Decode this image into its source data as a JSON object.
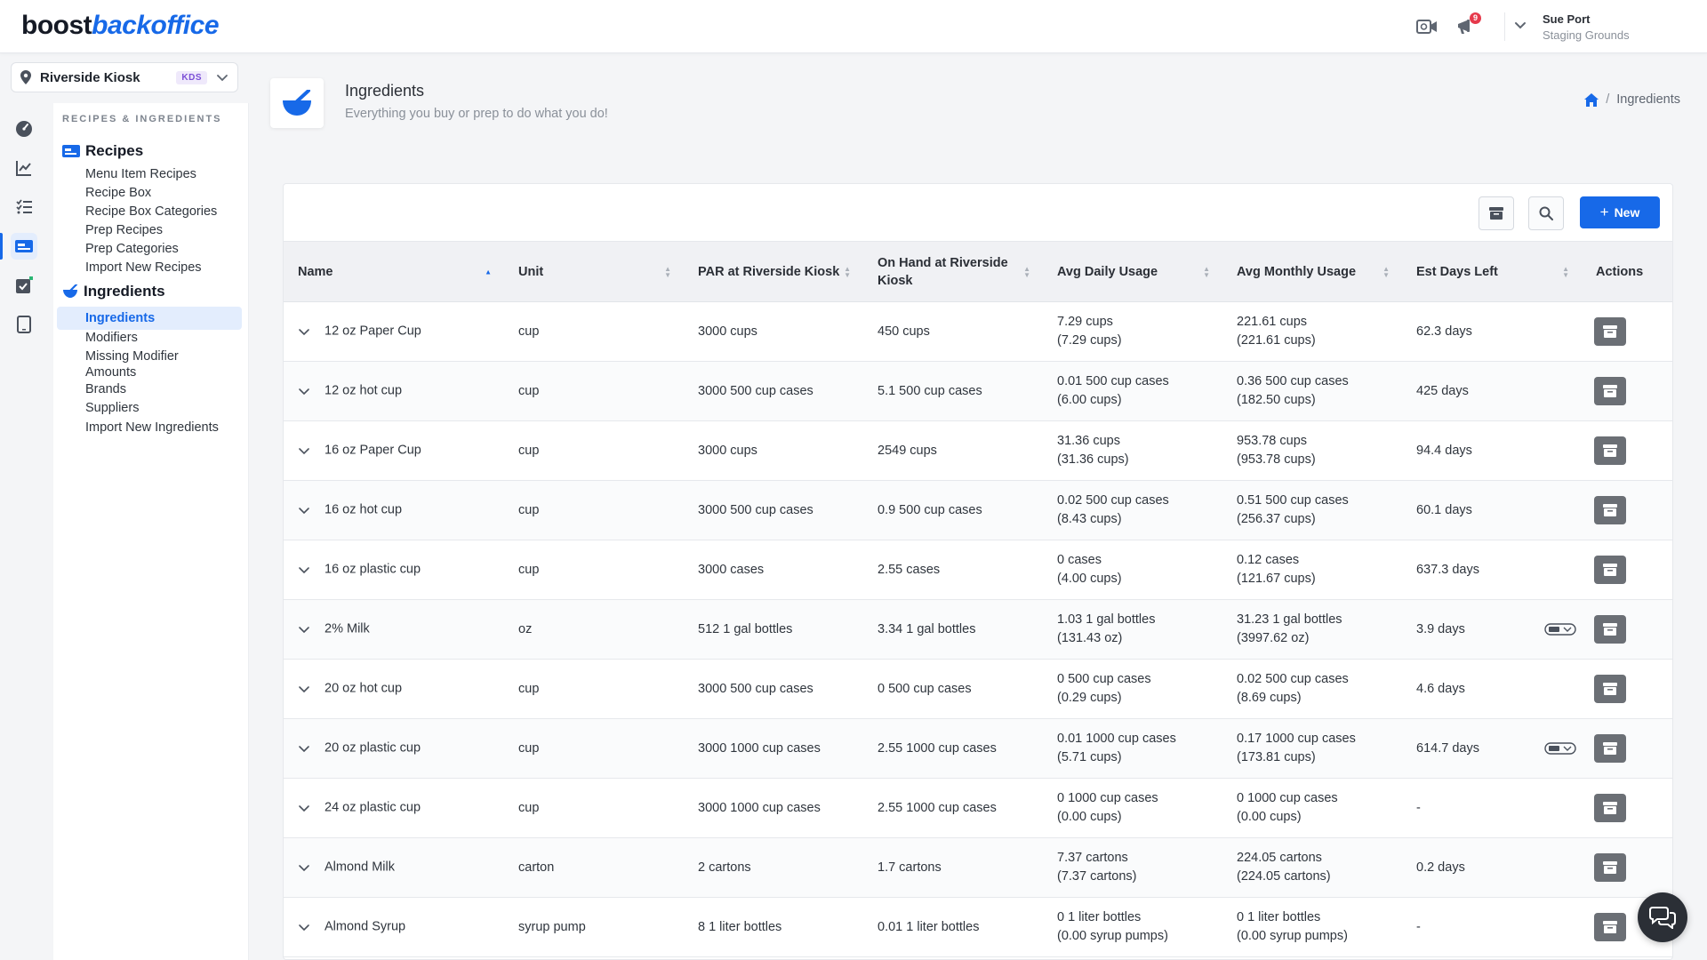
{
  "brand": {
    "part1": "boost",
    "part2": "backoffice"
  },
  "header": {
    "notification_count": "9",
    "user_name": "Sue Port",
    "user_org": "Staging Grounds"
  },
  "location": {
    "name": "Riverside Kiosk",
    "badge": "KDS"
  },
  "sidebar": {
    "section_title": "RECIPES & INGREDIENTS",
    "recipes_group": "Recipes",
    "recipes_links": [
      "Menu Item Recipes",
      "Recipe Box",
      "Recipe Box Categories",
      "Prep Recipes",
      "Prep Categories",
      "Import New Recipes"
    ],
    "ingredients_group": "Ingredients",
    "ingredients_links": [
      "Ingredients",
      "Modifiers",
      "Missing Modifier Amounts",
      "Brands",
      "Suppliers",
      "Import New Ingredients"
    ]
  },
  "page": {
    "title": "Ingredients",
    "subtitle": "Everything you buy or prep to do what you do!",
    "breadcrumb_current": "Ingredients"
  },
  "toolbar": {
    "new_label": "New"
  },
  "table": {
    "columns": [
      "Name",
      "Unit",
      "PAR at Riverside Kiosk",
      "On Hand at Riverside Kiosk",
      "Avg Daily Usage",
      "Avg Monthly Usage",
      "Est Days Left",
      "Actions"
    ],
    "rows": [
      {
        "name": "12 oz Paper Cup",
        "unit": "cup",
        "par": "3000 cups",
        "on_hand": "450 cups",
        "daily_1": "7.29 cups",
        "daily_2": "(7.29 cups)",
        "monthly_1": "221.61 cups",
        "monthly_2": "(221.61 cups)",
        "days_left": "62.3 days",
        "toggle_icon": false
      },
      {
        "name": "12 oz hot cup",
        "unit": "cup",
        "par": "3000 500 cup cases",
        "on_hand": "5.1 500 cup cases",
        "daily_1": "0.01 500 cup cases",
        "daily_2": "(6.00 cups)",
        "monthly_1": "0.36 500 cup cases",
        "monthly_2": "(182.50 cups)",
        "days_left": "425 days",
        "toggle_icon": false
      },
      {
        "name": "16 oz Paper Cup",
        "unit": "cup",
        "par": "3000 cups",
        "on_hand": "2549 cups",
        "daily_1": "31.36 cups",
        "daily_2": "(31.36 cups)",
        "monthly_1": "953.78 cups",
        "monthly_2": "(953.78 cups)",
        "days_left": "94.4 days",
        "toggle_icon": false
      },
      {
        "name": "16 oz hot cup",
        "unit": "cup",
        "par": "3000 500 cup cases",
        "on_hand": "0.9 500 cup cases",
        "daily_1": "0.02 500 cup cases",
        "daily_2": "(8.43 cups)",
        "monthly_1": "0.51 500 cup cases",
        "monthly_2": "(256.37 cups)",
        "days_left": "60.1 days",
        "toggle_icon": false
      },
      {
        "name": "16 oz plastic cup",
        "unit": "cup",
        "par": "3000 cases",
        "on_hand": "2.55 cases",
        "daily_1": "0 cases",
        "daily_2": "(4.00 cups)",
        "monthly_1": "0.12 cases",
        "monthly_2": "(121.67 cups)",
        "days_left": "637.3 days",
        "toggle_icon": false
      },
      {
        "name": "2% Milk",
        "unit": "oz",
        "par": "512 1 gal bottles",
        "on_hand": "3.34 1 gal bottles",
        "daily_1": "1.03 1 gal bottles",
        "daily_2": "(131.43 oz)",
        "monthly_1": "31.23 1 gal bottles",
        "monthly_2": "(3997.62 oz)",
        "days_left": "3.9 days",
        "toggle_icon": true
      },
      {
        "name": "20 oz hot cup",
        "unit": "cup",
        "par": "3000 500 cup cases",
        "on_hand": "0 500 cup cases",
        "daily_1": "0 500 cup cases",
        "daily_2": "(0.29 cups)",
        "monthly_1": "0.02 500 cup cases",
        "monthly_2": "(8.69 cups)",
        "days_left": "4.6 days",
        "toggle_icon": false
      },
      {
        "name": "20 oz plastic cup",
        "unit": "cup",
        "par": "3000 1000 cup cases",
        "on_hand": "2.55 1000 cup cases",
        "daily_1": "0.01 1000 cup cases",
        "daily_2": "(5.71 cups)",
        "monthly_1": "0.17 1000 cup cases",
        "monthly_2": "(173.81 cups)",
        "days_left": "614.7 days",
        "toggle_icon": true
      },
      {
        "name": "24 oz plastic cup",
        "unit": "cup",
        "par": "3000 1000 cup cases",
        "on_hand": "2.55 1000 cup cases",
        "daily_1": "0 1000 cup cases",
        "daily_2": "(0.00 cups)",
        "monthly_1": "0 1000 cup cases",
        "monthly_2": "(0.00 cups)",
        "days_left": "-",
        "toggle_icon": false
      },
      {
        "name": "Almond Milk",
        "unit": "carton",
        "par": "2 cartons",
        "on_hand": "1.7 cartons",
        "daily_1": "7.37 cartons",
        "daily_2": "(7.37 cartons)",
        "monthly_1": "224.05 cartons",
        "monthly_2": "(224.05 cartons)",
        "days_left": "0.2 days",
        "toggle_icon": false
      },
      {
        "name": "Almond Syrup",
        "unit": "syrup pump",
        "par": "8 1 liter bottles",
        "on_hand": "0.01 1 liter bottles",
        "daily_1": "0 1 liter bottles",
        "daily_2": "(0.00 syrup pumps)",
        "monthly_1": "0 1 liter bottles",
        "monthly_2": "(0.00 syrup pumps)",
        "days_left": "-",
        "toggle_icon": false
      }
    ]
  },
  "colors": {
    "accent": "#1769e8",
    "header_bg": "#f0f1f4",
    "action_btn": "#6b6f75"
  }
}
